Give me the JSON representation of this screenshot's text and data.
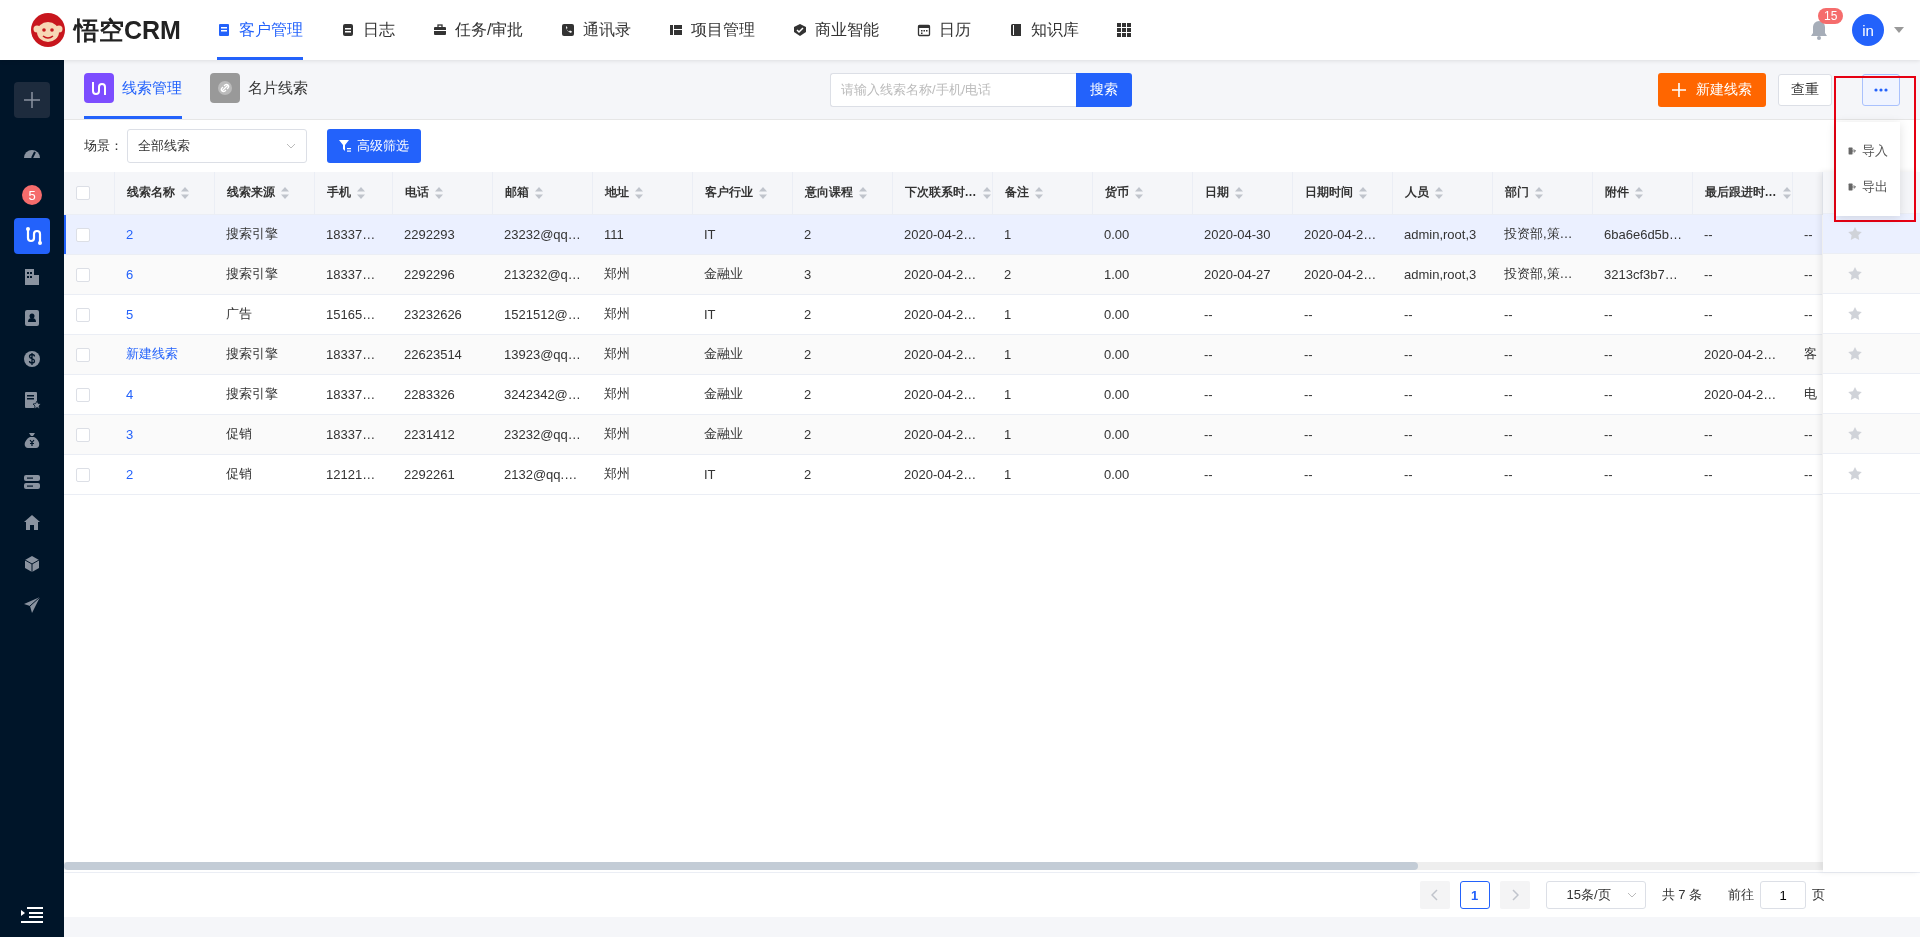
{
  "header": {
    "logo_text": "悟空CRM",
    "nav": [
      {
        "label": "客户管理",
        "selected": true
      },
      {
        "label": "日志",
        "selected": false
      },
      {
        "label": "任务/审批",
        "selected": false
      },
      {
        "label": "通讯录",
        "selected": false
      },
      {
        "label": "项目管理",
        "selected": false
      },
      {
        "label": "商业智能",
        "selected": false
      },
      {
        "label": "日历",
        "selected": false
      },
      {
        "label": "知识库",
        "selected": false
      }
    ],
    "notification_count": "15",
    "avatar_initials": "in"
  },
  "sidebar": {
    "items": [
      {
        "selected": false
      },
      {
        "selected": false,
        "badge": "5"
      },
      {
        "selected": true
      },
      {
        "selected": false
      },
      {
        "selected": false
      },
      {
        "selected": false
      },
      {
        "selected": false
      },
      {
        "selected": false
      },
      {
        "selected": false
      },
      {
        "selected": false
      },
      {
        "selected": false
      },
      {
        "selected": false
      }
    ]
  },
  "tabs": [
    {
      "label": "线索管理",
      "selected": true
    },
    {
      "label": "名片线索",
      "selected": false
    }
  ],
  "search": {
    "placeholder": "请输入线索名称/手机/电话",
    "button": "搜索"
  },
  "actions": {
    "create": "新建线索",
    "dedupe": "查重"
  },
  "more_menu": {
    "items": [
      "导入",
      "导出"
    ]
  },
  "filter": {
    "scene_label": "场景：",
    "scene_value": "全部线索",
    "advanced_button": "高级筛选"
  },
  "table": {
    "select_all_checked": false,
    "columns": [
      "线索名称",
      "线索来源",
      "手机",
      "电话",
      "邮箱",
      "地址",
      "客户行业",
      "意向课程",
      "下次联系时…",
      "备注",
      "货币",
      "日期",
      "日期时间",
      "人员",
      "部门",
      "附件",
      "最后跟进时…"
    ],
    "rows": [
      {
        "selected": true,
        "checked": false,
        "starred": false,
        "cells": [
          "2",
          "搜索引擎",
          "18337…",
          "2292293",
          "23232@qq…",
          "111",
          "IT",
          "2",
          "2020-04-2…",
          "1",
          "0.00",
          "2020-04-30",
          "2020-04-2…",
          "admin,root,3",
          "投资部,策…",
          "6ba6e6d5b…",
          "--",
          "--"
        ]
      },
      {
        "selected": false,
        "checked": false,
        "starred": false,
        "cells": [
          "6",
          "搜索引擎",
          "18337…",
          "2292296",
          "213232@q…",
          "郑州",
          "金融业",
          "3",
          "2020-04-2…",
          "2",
          "1.00",
          "2020-04-27",
          "2020-04-2…",
          "admin,root,3",
          "投资部,策…",
          "3213cf3b7…",
          "--",
          "--"
        ]
      },
      {
        "selected": false,
        "checked": false,
        "starred": false,
        "cells": [
          "5",
          "广告",
          "15165…",
          "23232626",
          "1521512@…",
          "郑州",
          "IT",
          "2",
          "2020-04-2…",
          "1",
          "0.00",
          "--",
          "--",
          "--",
          "--",
          "--",
          "--",
          "--"
        ]
      },
      {
        "selected": false,
        "checked": false,
        "starred": false,
        "cells": [
          "新建线索",
          "搜索引擎",
          "18337…",
          "22623514",
          "13923@qq…",
          "郑州",
          "金融业",
          "2",
          "2020-04-2…",
          "1",
          "0.00",
          "--",
          "--",
          "--",
          "--",
          "--",
          "2020-04-2…",
          "客"
        ]
      },
      {
        "selected": false,
        "checked": false,
        "starred": false,
        "cells": [
          "4",
          "搜索引擎",
          "18337…",
          "2283326",
          "3242342@…",
          "郑州",
          "金融业",
          "2",
          "2020-04-2…",
          "1",
          "0.00",
          "--",
          "--",
          "--",
          "--",
          "--",
          "2020-04-2…",
          "电"
        ]
      },
      {
        "selected": false,
        "checked": false,
        "starred": false,
        "cells": [
          "3",
          "促销",
          "18337…",
          "2231412",
          "23232@qq…",
          "郑州",
          "金融业",
          "2",
          "2020-04-2…",
          "1",
          "0.00",
          "--",
          "--",
          "--",
          "--",
          "--",
          "--",
          "--"
        ]
      },
      {
        "selected": false,
        "checked": false,
        "starred": false,
        "cells": [
          "2",
          "促销",
          "12121…",
          "2292261",
          "2132@qq.…",
          "郑州",
          "IT",
          "2",
          "2020-04-2…",
          "1",
          "0.00",
          "--",
          "--",
          "--",
          "--",
          "--",
          "--",
          "--"
        ]
      }
    ]
  },
  "pagination": {
    "page": "1",
    "page_size": "15条/页",
    "total": "共 7 条",
    "goto_label": "前往",
    "goto_value": "1",
    "page_suffix": "页"
  }
}
